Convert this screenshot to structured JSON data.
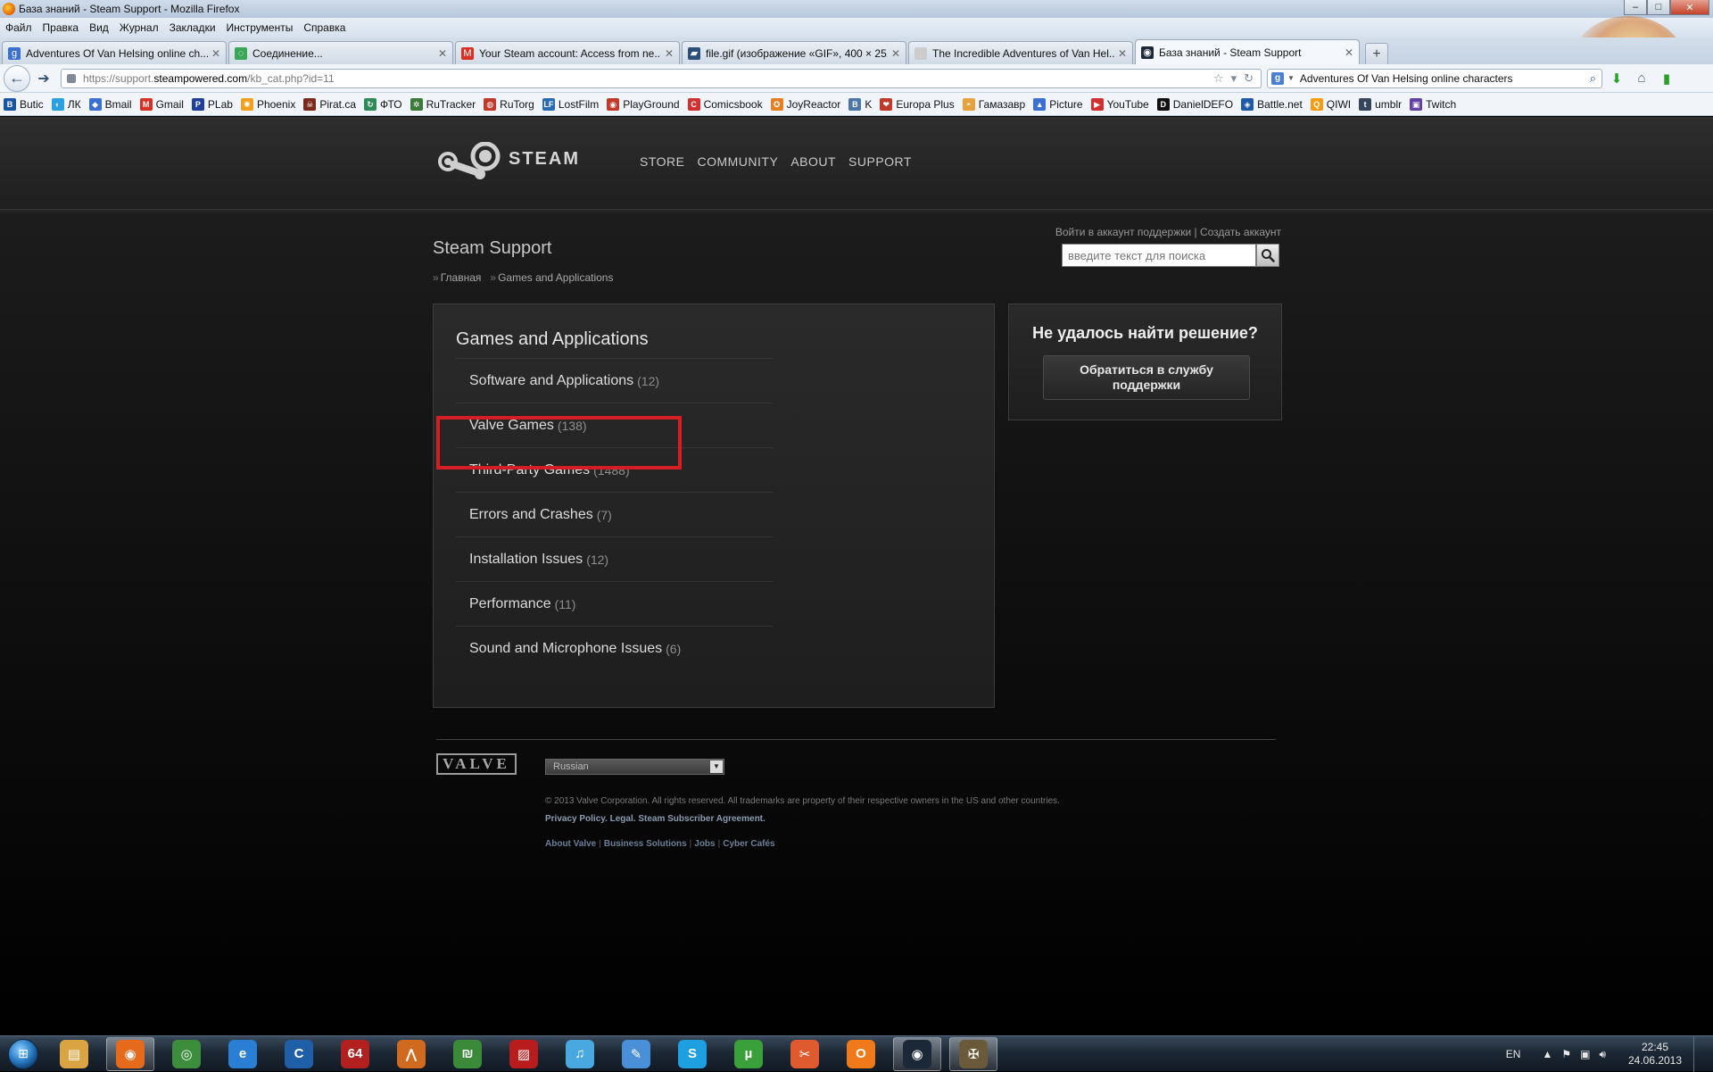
{
  "window": {
    "title": "База знаний - Steam Support - Mozilla Firefox"
  },
  "menu": [
    "Файл",
    "Правка",
    "Вид",
    "Журнал",
    "Закладки",
    "Инструменты",
    "Справка"
  ],
  "tabs": [
    {
      "label": "Adventures Of Van Helsing online ch...",
      "icon_color": "#3b6fd1",
      "icon_char": "g"
    },
    {
      "label": "Соединение...",
      "icon_color": "#3aa757",
      "icon_char": "◌"
    },
    {
      "label": "Your Steam account: Access from ne...",
      "icon_color": "#d93025",
      "icon_char": "M"
    },
    {
      "label": "file.gif (изображение «GIF», 400 × 25...",
      "icon_color": "#2c4f7a",
      "icon_char": "▰"
    },
    {
      "label": "The Incredible Adventures of Van Hel...",
      "icon_color": "#cccccc",
      "icon_char": ""
    },
    {
      "label": "База знаний - Steam Support",
      "icon_color": "#1b2838",
      "icon_char": "◉"
    }
  ],
  "address": {
    "prefix": "https://support.",
    "host": "steampowered.com",
    "path": "/kb_cat.php?id=11"
  },
  "browser_search": {
    "value": "Adventures Of Van Helsing online characters"
  },
  "bookmarks": [
    {
      "label": "Butic",
      "color": "#1a57a3",
      "char": "B"
    },
    {
      "label": "ЛК",
      "color": "#2aa0e0",
      "char": "◐"
    },
    {
      "label": "Bmail",
      "color": "#3b6fd1",
      "char": "◆"
    },
    {
      "label": "Gmail",
      "color": "#d93025",
      "char": "M"
    },
    {
      "label": "PLab",
      "color": "#1f3f9a",
      "char": "P"
    },
    {
      "label": "Phoenix",
      "color": "#f0a020",
      "char": "✺"
    },
    {
      "label": "Pirat.ca",
      "color": "#7a2a1a",
      "char": "☠"
    },
    {
      "label": "ФТО",
      "color": "#2e8b57",
      "char": "↻"
    },
    {
      "label": "RuTracker",
      "color": "#3a7a3a",
      "char": "✲"
    },
    {
      "label": "RuTorg",
      "color": "#c0392b",
      "char": "◍"
    },
    {
      "label": "LostFilm",
      "color": "#2b6cb0",
      "char": "LF"
    },
    {
      "label": "PlayGround",
      "color": "#c0392b",
      "char": "◉"
    },
    {
      "label": "Comicsbook",
      "color": "#d32f2f",
      "char": "C"
    },
    {
      "label": "JoyReactor",
      "color": "#e67e22",
      "char": "✪"
    },
    {
      "label": "K",
      "color": "#4a76a8",
      "char": "B"
    },
    {
      "label": "Europa Plus",
      "color": "#c0392b",
      "char": "❤"
    },
    {
      "label": "Гамазавр",
      "color": "#e6a23c",
      "char": "◓"
    },
    {
      "label": "Picture",
      "color": "#3b6fd1",
      "char": "▲"
    },
    {
      "label": "YouTube",
      "color": "#d32f2f",
      "char": "▶"
    },
    {
      "label": "DanielDEFO",
      "color": "#111111",
      "char": "D"
    },
    {
      "label": "Battle.net",
      "color": "#1e5aa8",
      "char": "◈"
    },
    {
      "label": "QIWI",
      "color": "#f39c12",
      "char": "Q"
    },
    {
      "label": "umblr",
      "color": "#35465c",
      "char": "t"
    },
    {
      "label": "Twitch",
      "color": "#6441a5",
      "char": "▣"
    }
  ],
  "steam": {
    "wordmark": "STEAM",
    "nav": [
      "STORE",
      "COMMUNITY",
      "ABOUT",
      "SUPPORT"
    ],
    "support_title": "Steam Support",
    "breadcrumb": [
      "Главная",
      "Games and Applications"
    ],
    "account_links": "Войти в аккаунт поддержки | Создать аккаунт",
    "search_placeholder": "введите текст для поиска"
  },
  "kb": {
    "heading": "Games and Applications",
    "items": [
      {
        "label": "Software and Applications",
        "count": "(12)"
      },
      {
        "label": "Valve Games",
        "count": "(138)"
      },
      {
        "label": "Third-Party Games",
        "count": "(1488)"
      },
      {
        "label": "Errors and Crashes",
        "count": "(7)"
      },
      {
        "label": "Installation Issues",
        "count": "(12)"
      },
      {
        "label": "Performance",
        "count": "(11)"
      },
      {
        "label": "Sound and Microphone Issues",
        "count": "(6)"
      }
    ],
    "highlight_color": "#d51d24"
  },
  "help": {
    "heading": "Не удалось найти решение?",
    "button": "Обратиться в службу поддержки"
  },
  "footer": {
    "valve": "VALVE",
    "language": "Russian",
    "copyright": "© 2013 Valve Corporation. All rights reserved. All trademarks are property of their respective owners in the US and other countries.",
    "policy_links": [
      "Privacy Policy.",
      "Legal.",
      "Steam Subscriber Agreement."
    ],
    "links": [
      "About Valve",
      "Business Solutions",
      "Jobs",
      "Cyber Cafés"
    ]
  },
  "taskbar": {
    "apps": [
      {
        "name": "explorer",
        "color": "#d9a441",
        "char": "▤"
      },
      {
        "name": "firefox",
        "color": "#e56a1b",
        "char": "◉"
      },
      {
        "name": "chrome",
        "color": "#3c8d3c",
        "char": "◎"
      },
      {
        "name": "ie",
        "color": "#2a7fd4",
        "char": "e"
      },
      {
        "name": "ccleaner",
        "color": "#1f5fa8",
        "char": "C"
      },
      {
        "name": "aida64",
        "color": "#b32020",
        "char": "64"
      },
      {
        "name": "launcher",
        "color": "#d06a1e",
        "char": "⋀"
      },
      {
        "name": "money",
        "color": "#3a8a3a",
        "char": "₪"
      },
      {
        "name": "striped",
        "color": "#b81c1c",
        "char": "▨"
      },
      {
        "name": "music",
        "color": "#4aa8e0",
        "char": "♫"
      },
      {
        "name": "tool",
        "color": "#4a90d9",
        "char": "✎"
      },
      {
        "name": "skype",
        "color": "#1e9fe0",
        "char": "S"
      },
      {
        "name": "utorrent",
        "color": "#3aa03a",
        "char": "µ"
      },
      {
        "name": "paint",
        "color": "#e05a30",
        "char": "✂"
      },
      {
        "name": "origin",
        "color": "#f07a1a",
        "char": "O"
      },
      {
        "name": "steam",
        "color": "#1b2838",
        "char": "◉"
      },
      {
        "name": "game",
        "color": "#6a5a3a",
        "char": "✠"
      }
    ],
    "active": [
      "firefox",
      "steam",
      "game"
    ],
    "lang": "EN",
    "time": "22:45",
    "date": "24.06.2013"
  }
}
